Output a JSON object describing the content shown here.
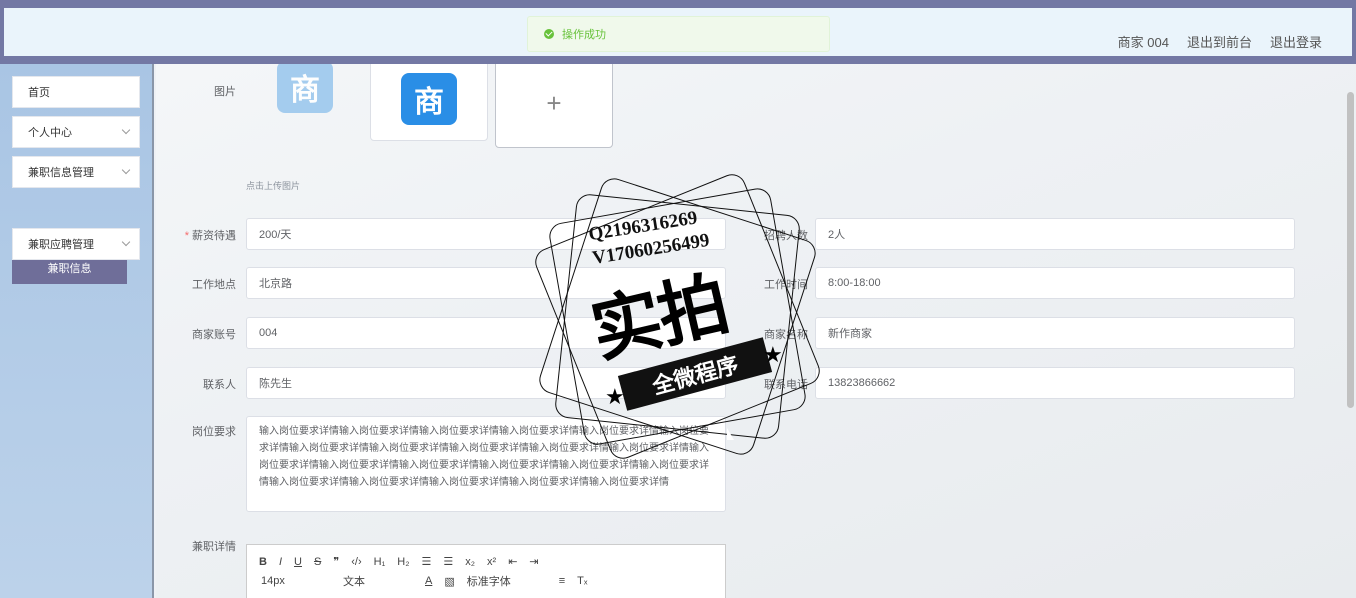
{
  "header": {
    "merchant": "商家 004",
    "back_to_front": "退出到前台",
    "logout": "退出登录"
  },
  "toast": {
    "message": "操作成功"
  },
  "sidebar": {
    "items": [
      {
        "label": "首页"
      },
      {
        "label": "个人中心"
      },
      {
        "label": "兼职信息管理"
      },
      {
        "label": "兼职应聘管理"
      }
    ],
    "sub_active": "兼职信息"
  },
  "form": {
    "image_label": "图片",
    "upload_hint": "点击上传图片",
    "salary_label": "薪资待遇",
    "salary_value": "200/天",
    "recruit_label": "招聘人数",
    "recruit_value": "2人",
    "location_label": "工作地点",
    "location_value": "北京路",
    "time_label": "工作时间",
    "time_value": "8:00-18:00",
    "account_label": "商家账号",
    "account_value": "004",
    "name_label": "商家名称",
    "name_value": "新作商家",
    "contact_label": "联系人",
    "contact_value": "陈先生",
    "phone_label": "联系电话",
    "phone_value": "13823866662",
    "req_label": "岗位要求",
    "req_value": "输入岗位要求详情输入岗位要求详情输入岗位要求详情输入岗位要求详情输入岗位要求详情输入岗位要求详情输入岗位要求详情输入岗位要求详情输入岗位要求详情输入岗位要求详情输入岗位要求详情输入岗位要求详情输入岗位要求详情输入岗位要求详情输入岗位要求详情输入岗位要求详情输入岗位要求详情输入岗位要求详情输入岗位要求详情输入岗位要求详情输入岗位要求详情输入岗位要求详情",
    "detail_label": "兼职详情"
  },
  "editor": {
    "font_size": "14px",
    "text_type": "文本",
    "font_family": "标准字体"
  },
  "stamp": {
    "qq": "Q2196316269",
    "v": "V17060256499",
    "big": "实拍",
    "band": "全微程序"
  }
}
